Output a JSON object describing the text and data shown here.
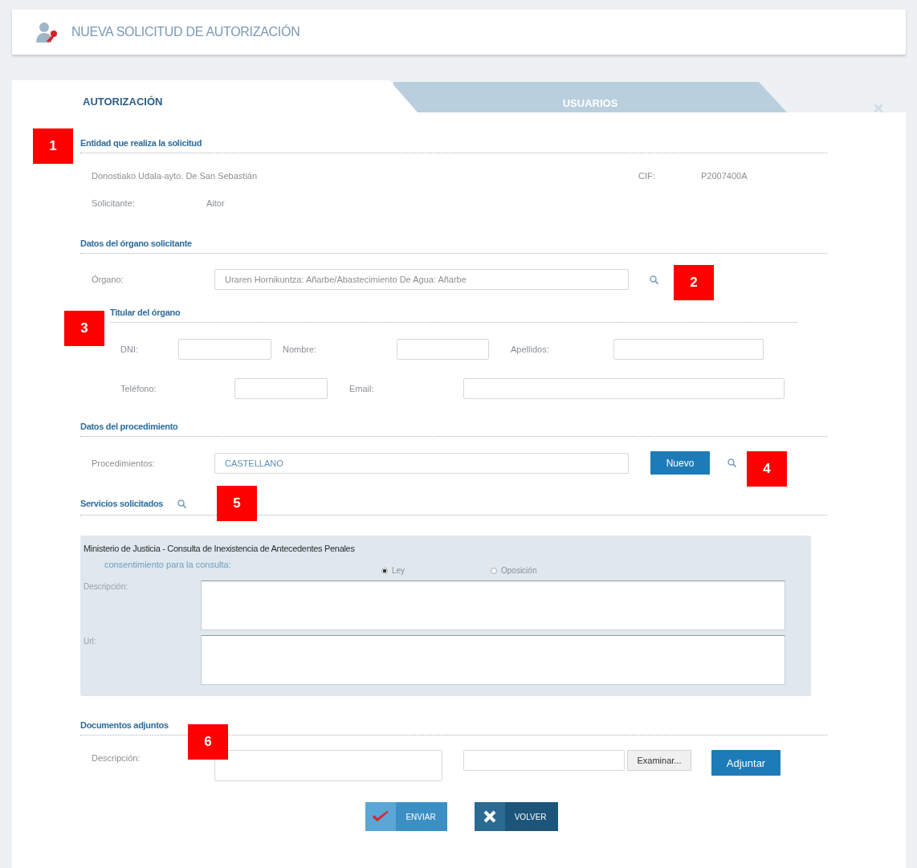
{
  "header": {
    "title": "NUEVA SOLICITUD DE AUTORIZACIÓN"
  },
  "tabs": [
    {
      "label": "AUTORIZACIÓN",
      "selected": true
    },
    {
      "label": "USUARIOS",
      "selected": false
    }
  ],
  "callouts": [
    "1",
    "2",
    "3",
    "4",
    "5",
    "6"
  ],
  "entity": {
    "heading": "Entidad que realiza la solicitud",
    "name": "Donostiako Udala-ayto. De San Sebastián",
    "cif_label": "CIF:",
    "cif": "P2007400A",
    "applicant_label": "Solicitante:",
    "applicant": "Aitor"
  },
  "organ": {
    "heading": "Datos del órgano solicitante",
    "label": "Órgano:",
    "value": "Uraren Hornikuntza: Añarbe/Abastecimiento De Agua: Añarbe"
  },
  "holder": {
    "heading": "Titular del órgano",
    "fields": [
      {
        "label": "DNI:"
      },
      {
        "label": "Nombre:"
      },
      {
        "label": "Apellidos:"
      },
      {
        "label": "Teléfono:"
      },
      {
        "label": "Email:"
      }
    ]
  },
  "procedure": {
    "heading": "Datos del procedimiento",
    "label": "Procedimientos:",
    "value": "CASTELLANO",
    "button": "Nuevo"
  },
  "services": {
    "heading": "Servicios solicitados",
    "items": [
      {
        "title": "Ministerio de Justicia - Consulta de Inexistencia de Antecedentes Penales",
        "consent_label": "consentimiento para la consulta:",
        "options": [
          {
            "label": "Ley",
            "selected": true
          },
          {
            "label": "Oposición",
            "selected": false
          }
        ],
        "description_label": "Descripción:",
        "url_label": "Url:"
      }
    ]
  },
  "attachments": {
    "heading": "Documentos adjuntos",
    "label": "Descripción:",
    "browse": "Examinar...",
    "button": "Adjuntar"
  },
  "actions": [
    {
      "kind": "send",
      "label": "ENVIAR"
    },
    {
      "kind": "back",
      "label": "VOLVER"
    }
  ]
}
